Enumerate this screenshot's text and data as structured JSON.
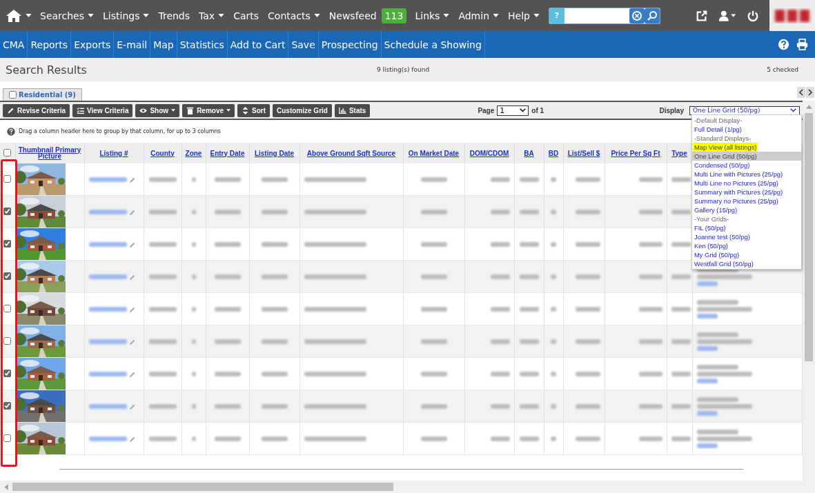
{
  "top_nav": {
    "items": [
      {
        "label": "Searches",
        "dropdown": true
      },
      {
        "label": "Listings",
        "dropdown": true
      },
      {
        "label": "Trends",
        "dropdown": false
      },
      {
        "label": "Tax",
        "dropdown": true
      },
      {
        "label": "Carts",
        "dropdown": false
      },
      {
        "label": "Contacts",
        "dropdown": true
      },
      {
        "label": "Newsfeed",
        "dropdown": false,
        "badge": "113"
      },
      {
        "label": "Links",
        "dropdown": true
      },
      {
        "label": "Admin",
        "dropdown": true
      },
      {
        "label": "Help",
        "dropdown": true
      }
    ],
    "search": {
      "help": "?"
    }
  },
  "action_bar": [
    "CMA",
    "Reports",
    "Exports",
    "E-mail",
    "Map",
    "Statistics",
    "Add to Cart",
    "Save",
    "Prospecting",
    "Schedule a Showing"
  ],
  "results": {
    "title": "Search Results",
    "found": "9 listing(s) found",
    "checked": "5 checked"
  },
  "tabs": [
    {
      "label": "Residential (9)",
      "checked": false
    }
  ],
  "toolbar": [
    {
      "label": "Revise Criteria",
      "kind": "pencil"
    },
    {
      "label": "View Criteria",
      "kind": "list"
    },
    {
      "label": "Show",
      "kind": "eye"
    },
    {
      "label": "Remove",
      "kind": "trash"
    },
    {
      "label": "Sort",
      "kind": "sort"
    },
    {
      "label": "Customize Grid",
      "kind": "none"
    },
    {
      "label": "Stats",
      "kind": "chart"
    }
  ],
  "pager": {
    "label": "Page",
    "value": "1",
    "of": "of 1"
  },
  "display": {
    "label": "Display",
    "value": "One Line Grid (50/pg)",
    "options": [
      {
        "label": "-Default Display-",
        "kind": "group",
        "selected": false,
        "highlighted": false
      },
      {
        "label": "Full Detail (1/pg)",
        "kind": "option",
        "selected": false,
        "highlighted": false
      },
      {
        "label": "-Standard Displays-",
        "kind": "group",
        "selected": false,
        "highlighted": false
      },
      {
        "label": "Map View (all listings)",
        "kind": "option",
        "selected": false,
        "highlighted": true
      },
      {
        "label": "One Line Grid (50/pg)",
        "kind": "option",
        "selected": true,
        "highlighted": false
      },
      {
        "label": "Condensed (50/pg)",
        "kind": "option",
        "selected": false,
        "highlighted": false
      },
      {
        "label": "Multi Line with Pictures (25/pg)",
        "kind": "option",
        "selected": false,
        "highlighted": false
      },
      {
        "label": "Multi Line no Pictures (25/pg)",
        "kind": "option",
        "selected": false,
        "highlighted": false
      },
      {
        "label": "Summary with Pictures (25/pg)",
        "kind": "option",
        "selected": false,
        "highlighted": false
      },
      {
        "label": "Summary no Pictures (25/pg)",
        "kind": "option",
        "selected": false,
        "highlighted": false
      },
      {
        "label": "Gallery (15/pg)",
        "kind": "option",
        "selected": false,
        "highlighted": false
      },
      {
        "label": "-Your Grids-",
        "kind": "group",
        "selected": false,
        "highlighted": false
      },
      {
        "label": "FIL (50/pg)",
        "kind": "option",
        "selected": false,
        "highlighted": false
      },
      {
        "label": "Joanne test (50/pg)",
        "kind": "option",
        "selected": false,
        "highlighted": false
      },
      {
        "label": "Ken (50/pg)",
        "kind": "option",
        "selected": false,
        "highlighted": false
      },
      {
        "label": "My Grid (50/pg)",
        "kind": "option",
        "selected": false,
        "highlighted": false
      },
      {
        "label": "Westfall Grid (50/pg)",
        "kind": "option",
        "selected": false,
        "highlighted": false
      }
    ]
  },
  "group_hint": "Drag a column header here to group by that column, for up to 3 columns",
  "table": {
    "columns": [
      "Thumbnail Primary Picture",
      "Listing #",
      "County",
      "Zone",
      "Entry Date",
      "Listing Date",
      "Above Ground Sqft Source",
      "On Market Date",
      "DOM/CDOM",
      "BA",
      "BD",
      "List/Sell $",
      "Price Per Sq Ft",
      "Type"
    ],
    "all_checked": false,
    "rows": [
      {
        "checked": false
      },
      {
        "checked": true
      },
      {
        "checked": true
      },
      {
        "checked": true
      },
      {
        "checked": false
      },
      {
        "checked": false
      },
      {
        "checked": true
      },
      {
        "checked": true
      },
      {
        "checked": false
      }
    ]
  }
}
